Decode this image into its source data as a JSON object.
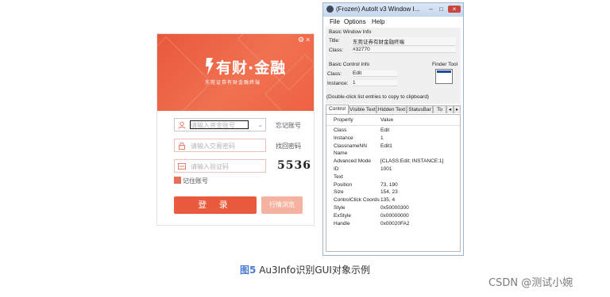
{
  "login_window": {
    "logo": {
      "brand_text": "有财·金融",
      "subtitle": "东莞证券有财金融终端"
    },
    "window_controls": [
      "⚙",
      "×"
    ],
    "account_field": {
      "placeholder": "请输入资金账号",
      "side_link": "忘记账号"
    },
    "password_field": {
      "placeholder": "请输入交易密码",
      "side_link": "找回密码"
    },
    "captcha_field": {
      "placeholder": "请输入验证码",
      "captcha_text": "5536"
    },
    "remember_label": "记住账号",
    "login_button": "登 录",
    "quote_button": "行情浏览",
    "colors": {
      "brand": "#ea5b3d",
      "quote_button": "#f6b2a0"
    }
  },
  "autoit_window": {
    "title": "(Frozen) AutoIt v3 Window I...",
    "title_buttons": [
      "–",
      "□",
      "×"
    ],
    "menu": [
      "File",
      "Options",
      "Help"
    ],
    "basic_window_info": {
      "header": "Basic Window Info",
      "title_label": "Title:",
      "title_value": "东莞证券有财金融终端",
      "class_label": "Class:",
      "class_value": "#32770"
    },
    "basic_control_info": {
      "header": "Basic Control Info",
      "class_label": "Class:",
      "class_value": "Edit",
      "instance_label": "Instance:",
      "instance_value": "1"
    },
    "finder_tool_label": "Finder Tool",
    "hint": "(Double-click list entries to copy to clipboard)",
    "tabs": [
      "Control",
      "Visible Text",
      "Hidden Text",
      "StatusBar",
      "To",
      "◂",
      "▸"
    ],
    "active_tab": "Control",
    "list_headers": [
      "Property",
      "Value"
    ],
    "properties": [
      {
        "name": "Class",
        "value": "Edit"
      },
      {
        "name": "Instance",
        "value": "1"
      },
      {
        "name": "ClassnameNN",
        "value": "Edit1"
      },
      {
        "name": "Name",
        "value": ""
      },
      {
        "name": "Advanced Mode",
        "value": "[CLASS:Edit; INSTANCE:1]"
      },
      {
        "name": "ID",
        "value": "1001"
      },
      {
        "name": "Text",
        "value": ""
      },
      {
        "name": "Position",
        "value": "73, 190"
      },
      {
        "name": "Size",
        "value": "154, 23"
      },
      {
        "name": "ControlClick Coords",
        "value": "135, 4"
      },
      {
        "name": "Style",
        "value": "0x50000300"
      },
      {
        "name": "ExStyle",
        "value": "0x00000000"
      },
      {
        "name": "Handle",
        "value": "0x00020FA2"
      }
    ]
  },
  "caption": {
    "figure_label": "图5",
    "text": "Au3Info识别GUI对象示例"
  },
  "watermark": "CSDN @测试小婉"
}
